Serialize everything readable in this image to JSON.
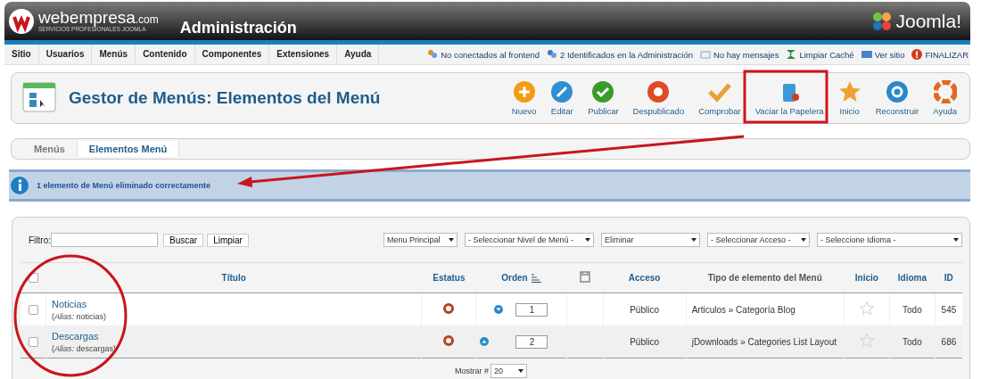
{
  "header": {
    "brand": "webempresa",
    "brand_suffix": ".com",
    "tagline": "SERVICIOS PROFESIONALES JOOMLA",
    "title": "Administración",
    "product": "Joomla!"
  },
  "menu": [
    "Sitio",
    "Usuarios",
    "Menús",
    "Contenido",
    "Componentes",
    "Extensiones",
    "Ayuda"
  ],
  "status": [
    {
      "kind": "visitors",
      "label": "No conectados al frontend"
    },
    {
      "kind": "admins",
      "label": "2 Identificados en la Administración"
    },
    {
      "kind": "messages",
      "label": "No hay mensajes"
    },
    {
      "kind": "cache",
      "label": "Limpiar Caché"
    },
    {
      "kind": "site",
      "label": "Ver sitio"
    },
    {
      "kind": "logout",
      "label": "FINALIZAR"
    }
  ],
  "page_title": "Gestor de Menús: Elementos del Menú",
  "toolbar": [
    {
      "kind": "new",
      "label": "Nuevo"
    },
    {
      "kind": "edit",
      "label": "Editar"
    },
    {
      "kind": "publish",
      "label": "Publicar"
    },
    {
      "kind": "unpublish",
      "label": "Despublicado"
    },
    {
      "kind": "check",
      "label": "Comprobar"
    },
    {
      "kind": "trash",
      "label": "Vaciar la Papelera"
    },
    {
      "kind": "home",
      "label": "Inicio"
    },
    {
      "kind": "rebuild",
      "label": "Reconstruir"
    },
    {
      "kind": "help",
      "label": "Ayuda"
    }
  ],
  "tabs": [
    {
      "label": "Menús",
      "selected": false
    },
    {
      "label": "Elementos Menú",
      "selected": true
    }
  ],
  "message": "1 elemento de Menú eliminado correctamente",
  "filter": {
    "label": "Filtro:",
    "buttons": [
      "Buscar",
      "Limpiar"
    ],
    "selects": [
      "Menu Principal",
      "- Seleccionar Nivel de Menú -",
      "Eliminar",
      "- Seleccionar Acceso -",
      "- Seleccione Idioma -"
    ]
  },
  "table": {
    "columns": [
      "Título",
      "Estatus",
      "Orden",
      "Acceso",
      "Tipo de elemento del Menú",
      "Inicio",
      "Idioma",
      "ID"
    ],
    "select_all_checked": false,
    "rows": [
      {
        "title": "Noticias",
        "alias": "(*Alias:* noticias)",
        "checked": false,
        "published": false,
        "move_up": false,
        "move_down": true,
        "order": "1",
        "access": "Público",
        "type": "Articulos » Categoría Blog",
        "home": false,
        "language": "Todo",
        "id": "545"
      },
      {
        "title": "Descargas",
        "alias": "(*Alias:* descargas)",
        "checked": false,
        "published": false,
        "move_up": true,
        "move_down": false,
        "order": "2",
        "access": "Público",
        "type": "jDownloads » Categories List Layout",
        "home": false,
        "language": "Todo",
        "id": "686"
      }
    ]
  },
  "pagination": {
    "label": "Mostrar #",
    "value": "20"
  }
}
